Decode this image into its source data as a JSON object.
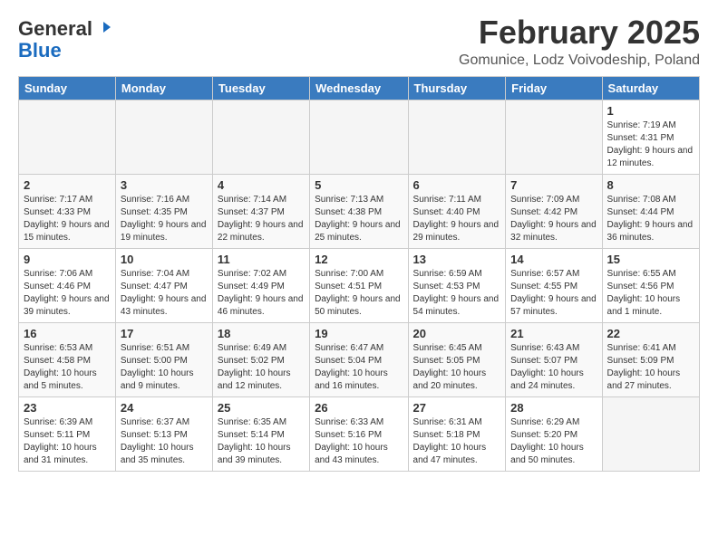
{
  "header": {
    "logo_general": "General",
    "logo_blue": "Blue",
    "month_title": "February 2025",
    "location": "Gomunice, Lodz Voivodeship, Poland"
  },
  "weekdays": [
    "Sunday",
    "Monday",
    "Tuesday",
    "Wednesday",
    "Thursday",
    "Friday",
    "Saturday"
  ],
  "weeks": [
    [
      {
        "day": "",
        "info": ""
      },
      {
        "day": "",
        "info": ""
      },
      {
        "day": "",
        "info": ""
      },
      {
        "day": "",
        "info": ""
      },
      {
        "day": "",
        "info": ""
      },
      {
        "day": "",
        "info": ""
      },
      {
        "day": "1",
        "info": "Sunrise: 7:19 AM\nSunset: 4:31 PM\nDaylight: 9 hours and 12 minutes."
      }
    ],
    [
      {
        "day": "2",
        "info": "Sunrise: 7:17 AM\nSunset: 4:33 PM\nDaylight: 9 hours and 15 minutes."
      },
      {
        "day": "3",
        "info": "Sunrise: 7:16 AM\nSunset: 4:35 PM\nDaylight: 9 hours and 19 minutes."
      },
      {
        "day": "4",
        "info": "Sunrise: 7:14 AM\nSunset: 4:37 PM\nDaylight: 9 hours and 22 minutes."
      },
      {
        "day": "5",
        "info": "Sunrise: 7:13 AM\nSunset: 4:38 PM\nDaylight: 9 hours and 25 minutes."
      },
      {
        "day": "6",
        "info": "Sunrise: 7:11 AM\nSunset: 4:40 PM\nDaylight: 9 hours and 29 minutes."
      },
      {
        "day": "7",
        "info": "Sunrise: 7:09 AM\nSunset: 4:42 PM\nDaylight: 9 hours and 32 minutes."
      },
      {
        "day": "8",
        "info": "Sunrise: 7:08 AM\nSunset: 4:44 PM\nDaylight: 9 hours and 36 minutes."
      }
    ],
    [
      {
        "day": "9",
        "info": "Sunrise: 7:06 AM\nSunset: 4:46 PM\nDaylight: 9 hours and 39 minutes."
      },
      {
        "day": "10",
        "info": "Sunrise: 7:04 AM\nSunset: 4:47 PM\nDaylight: 9 hours and 43 minutes."
      },
      {
        "day": "11",
        "info": "Sunrise: 7:02 AM\nSunset: 4:49 PM\nDaylight: 9 hours and 46 minutes."
      },
      {
        "day": "12",
        "info": "Sunrise: 7:00 AM\nSunset: 4:51 PM\nDaylight: 9 hours and 50 minutes."
      },
      {
        "day": "13",
        "info": "Sunrise: 6:59 AM\nSunset: 4:53 PM\nDaylight: 9 hours and 54 minutes."
      },
      {
        "day": "14",
        "info": "Sunrise: 6:57 AM\nSunset: 4:55 PM\nDaylight: 9 hours and 57 minutes."
      },
      {
        "day": "15",
        "info": "Sunrise: 6:55 AM\nSunset: 4:56 PM\nDaylight: 10 hours and 1 minute."
      }
    ],
    [
      {
        "day": "16",
        "info": "Sunrise: 6:53 AM\nSunset: 4:58 PM\nDaylight: 10 hours and 5 minutes."
      },
      {
        "day": "17",
        "info": "Sunrise: 6:51 AM\nSunset: 5:00 PM\nDaylight: 10 hours and 9 minutes."
      },
      {
        "day": "18",
        "info": "Sunrise: 6:49 AM\nSunset: 5:02 PM\nDaylight: 10 hours and 12 minutes."
      },
      {
        "day": "19",
        "info": "Sunrise: 6:47 AM\nSunset: 5:04 PM\nDaylight: 10 hours and 16 minutes."
      },
      {
        "day": "20",
        "info": "Sunrise: 6:45 AM\nSunset: 5:05 PM\nDaylight: 10 hours and 20 minutes."
      },
      {
        "day": "21",
        "info": "Sunrise: 6:43 AM\nSunset: 5:07 PM\nDaylight: 10 hours and 24 minutes."
      },
      {
        "day": "22",
        "info": "Sunrise: 6:41 AM\nSunset: 5:09 PM\nDaylight: 10 hours and 27 minutes."
      }
    ],
    [
      {
        "day": "23",
        "info": "Sunrise: 6:39 AM\nSunset: 5:11 PM\nDaylight: 10 hours and 31 minutes."
      },
      {
        "day": "24",
        "info": "Sunrise: 6:37 AM\nSunset: 5:13 PM\nDaylight: 10 hours and 35 minutes."
      },
      {
        "day": "25",
        "info": "Sunrise: 6:35 AM\nSunset: 5:14 PM\nDaylight: 10 hours and 39 minutes."
      },
      {
        "day": "26",
        "info": "Sunrise: 6:33 AM\nSunset: 5:16 PM\nDaylight: 10 hours and 43 minutes."
      },
      {
        "day": "27",
        "info": "Sunrise: 6:31 AM\nSunset: 5:18 PM\nDaylight: 10 hours and 47 minutes."
      },
      {
        "day": "28",
        "info": "Sunrise: 6:29 AM\nSunset: 5:20 PM\nDaylight: 10 hours and 50 minutes."
      },
      {
        "day": "",
        "info": ""
      }
    ]
  ]
}
